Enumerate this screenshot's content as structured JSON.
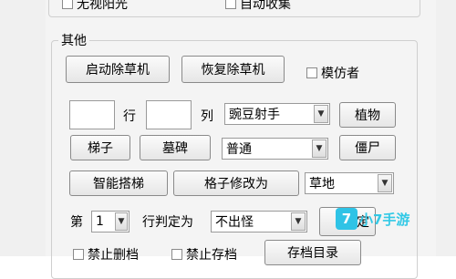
{
  "top_row": {
    "checkbox_no_sunlight": "无视阳光",
    "checkbox_auto_collect": "自动收集"
  },
  "other_group": {
    "title": "其他",
    "btn_start_mower": "启动除草机",
    "btn_restore_mower": "恢复除草机",
    "checkbox_imitator": "模仿者",
    "label_row": "行",
    "label_col": "列",
    "select_plant_value": "豌豆射手",
    "btn_plant": "植物",
    "btn_ladder": "梯子",
    "btn_gravestone": "墓碑",
    "select_zombie_value": "普通",
    "btn_zombie": "僵尸",
    "btn_smart_ladder": "智能搭梯",
    "btn_modify_grid": "格子修改为",
    "select_grid_value": "草地",
    "label_row_prefix": "第",
    "row_number": "1",
    "label_row_judged": "行判定为",
    "select_row_type_value": "不出怪",
    "btn_determine_partial": "定",
    "checkbox_no_delete_save": "禁止删档",
    "checkbox_no_save": "禁止存档",
    "btn_save_dir": "存档目录"
  },
  "watermark": {
    "logo_text": "7",
    "text": "小7手游"
  },
  "icons": {
    "dropdown": "chevron-down-icon",
    "number_arrow": "chevron-down-icon"
  },
  "colors": {
    "panel_bg": "#f4f4f4",
    "watermark": "#33c9e6"
  }
}
